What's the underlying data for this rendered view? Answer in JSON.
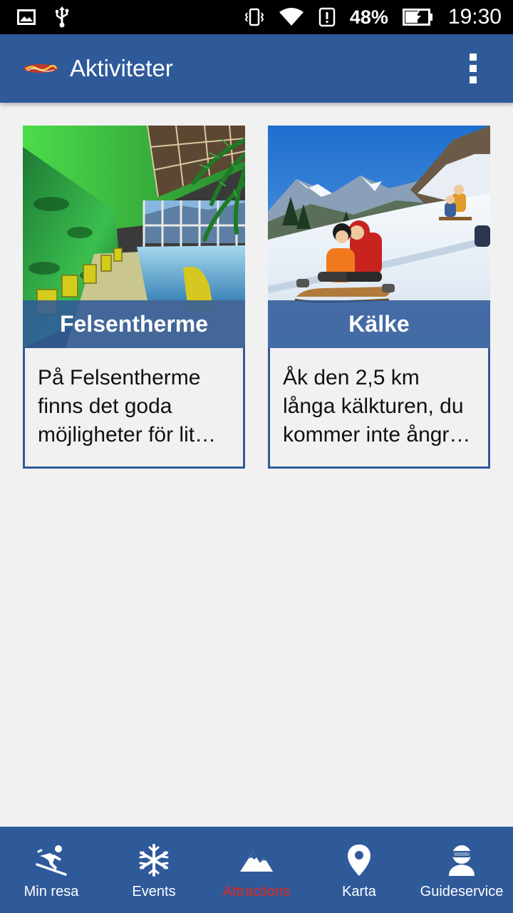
{
  "status_bar": {
    "battery_percent": "48%",
    "time": "19:30"
  },
  "app_bar": {
    "title": "Aktiviteter"
  },
  "cards": [
    {
      "title": "Felsentherme",
      "description": "På Felsentherme finns det goda möjligheter för lit…"
    },
    {
      "title": "Kälke",
      "description": "Åk den 2,5 km långa kälkturen, du kommer inte ångr…"
    }
  ],
  "bottom_nav": {
    "items": [
      {
        "label": "Min resa",
        "icon": "skier-icon",
        "active": false
      },
      {
        "label": "Events",
        "icon": "snowflake-icon",
        "active": false
      },
      {
        "label": "Attractions",
        "icon": "mountains-icon",
        "active": true
      },
      {
        "label": "Karta",
        "icon": "map-pin-icon",
        "active": false
      },
      {
        "label": "Guideservice",
        "icon": "guide-icon",
        "active": false
      }
    ]
  },
  "colors": {
    "primary": "#2f5a9a",
    "active_tab": "#e3271c",
    "background": "#f1f1f1"
  }
}
